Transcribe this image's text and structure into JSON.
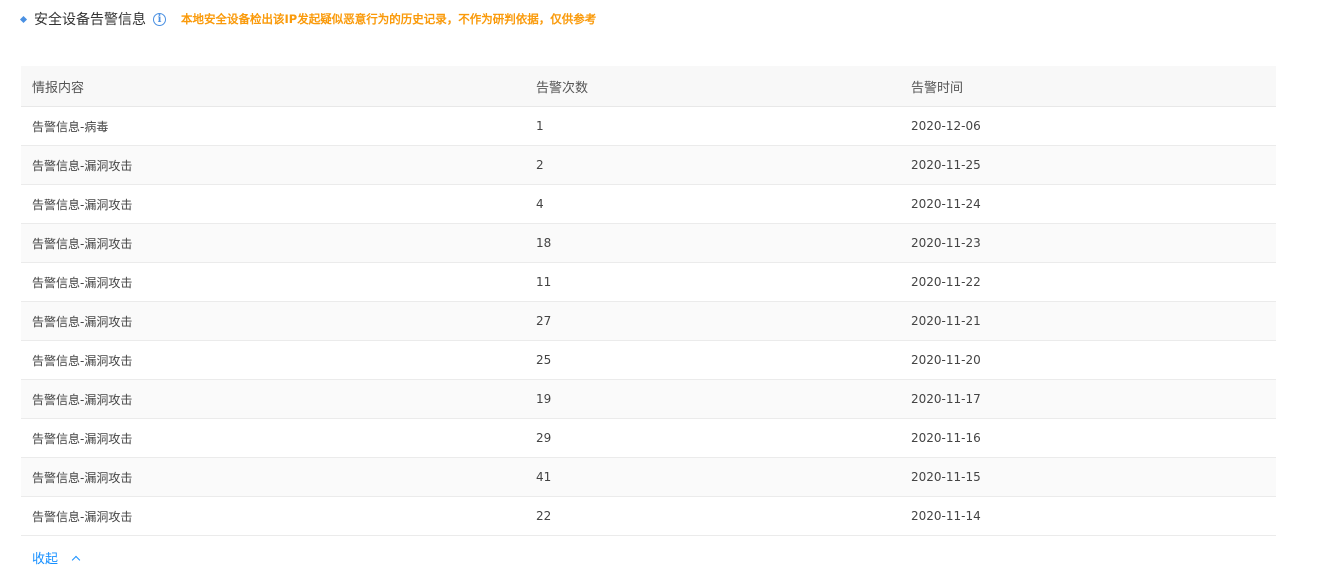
{
  "section": {
    "title": "安全设备告警信息",
    "note": "本地安全设备检出该IP发起疑似恶意行为的历史记录，不作为研判依据，仅供参考"
  },
  "table": {
    "headers": [
      "情报内容",
      "告警次数",
      "告警时间"
    ],
    "rows": [
      [
        "告警信息-病毒",
        "1",
        "2020-12-06"
      ],
      [
        "告警信息-漏洞攻击",
        "2",
        "2020-11-25"
      ],
      [
        "告警信息-漏洞攻击",
        "4",
        "2020-11-24"
      ],
      [
        "告警信息-漏洞攻击",
        "18",
        "2020-11-23"
      ],
      [
        "告警信息-漏洞攻击",
        "11",
        "2020-11-22"
      ],
      [
        "告警信息-漏洞攻击",
        "27",
        "2020-11-21"
      ],
      [
        "告警信息-漏洞攻击",
        "25",
        "2020-11-20"
      ],
      [
        "告警信息-漏洞攻击",
        "19",
        "2020-11-17"
      ],
      [
        "告警信息-漏洞攻击",
        "29",
        "2020-11-16"
      ],
      [
        "告警信息-漏洞攻击",
        "41",
        "2020-11-15"
      ],
      [
        "告警信息-漏洞攻击",
        "22",
        "2020-11-14"
      ]
    ]
  },
  "collapse_label": "收起"
}
